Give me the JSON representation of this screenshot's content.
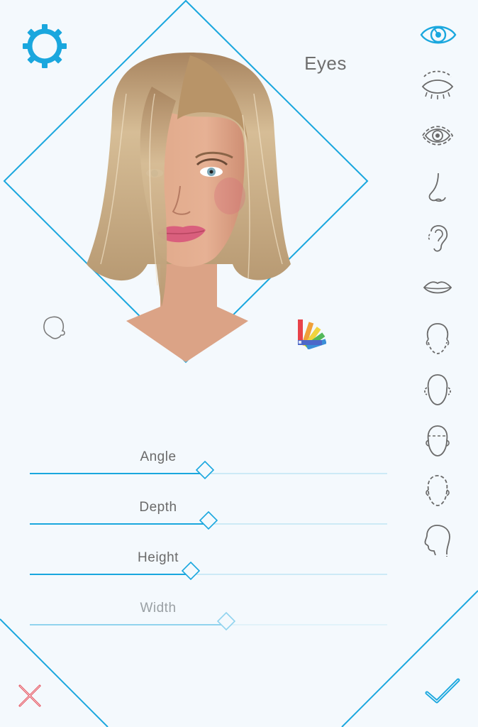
{
  "header": {
    "section_title": "Eyes"
  },
  "settings": {
    "icon": "gear-icon"
  },
  "preview": {
    "character": "female-avatar-portrait"
  },
  "tools": {
    "head_rotate_icon": "head-outline-icon",
    "color_palette_icon": "color-swatch-icon"
  },
  "sidebar": {
    "items": [
      {
        "name": "eye-icon",
        "active": true
      },
      {
        "name": "eyelid-icon",
        "active": false
      },
      {
        "name": "eyeball-icon",
        "active": false
      },
      {
        "name": "nose-icon",
        "active": false
      },
      {
        "name": "ear-icon",
        "active": false
      },
      {
        "name": "lips-icon",
        "active": false
      },
      {
        "name": "jaw-icon",
        "active": false
      },
      {
        "name": "cheeks-icon",
        "active": false
      },
      {
        "name": "forehead-icon",
        "active": false
      },
      {
        "name": "face-shape-icon",
        "active": false
      },
      {
        "name": "head-profile-icon",
        "active": false
      }
    ]
  },
  "sliders": [
    {
      "label": "Angle",
      "value": 0.49,
      "enabled": true
    },
    {
      "label": "Depth",
      "value": 0.5,
      "enabled": true
    },
    {
      "label": "Height",
      "value": 0.45,
      "enabled": true
    },
    {
      "label": "Width",
      "value": 0.55,
      "enabled": false
    }
  ],
  "footer": {
    "cancel_icon": "close-icon",
    "confirm_icon": "checkmark-icon"
  },
  "colors": {
    "accent": "#1aa7de",
    "cancel": "#e8505b",
    "text": "#6e6e6e",
    "background": "#f4f9fd"
  }
}
